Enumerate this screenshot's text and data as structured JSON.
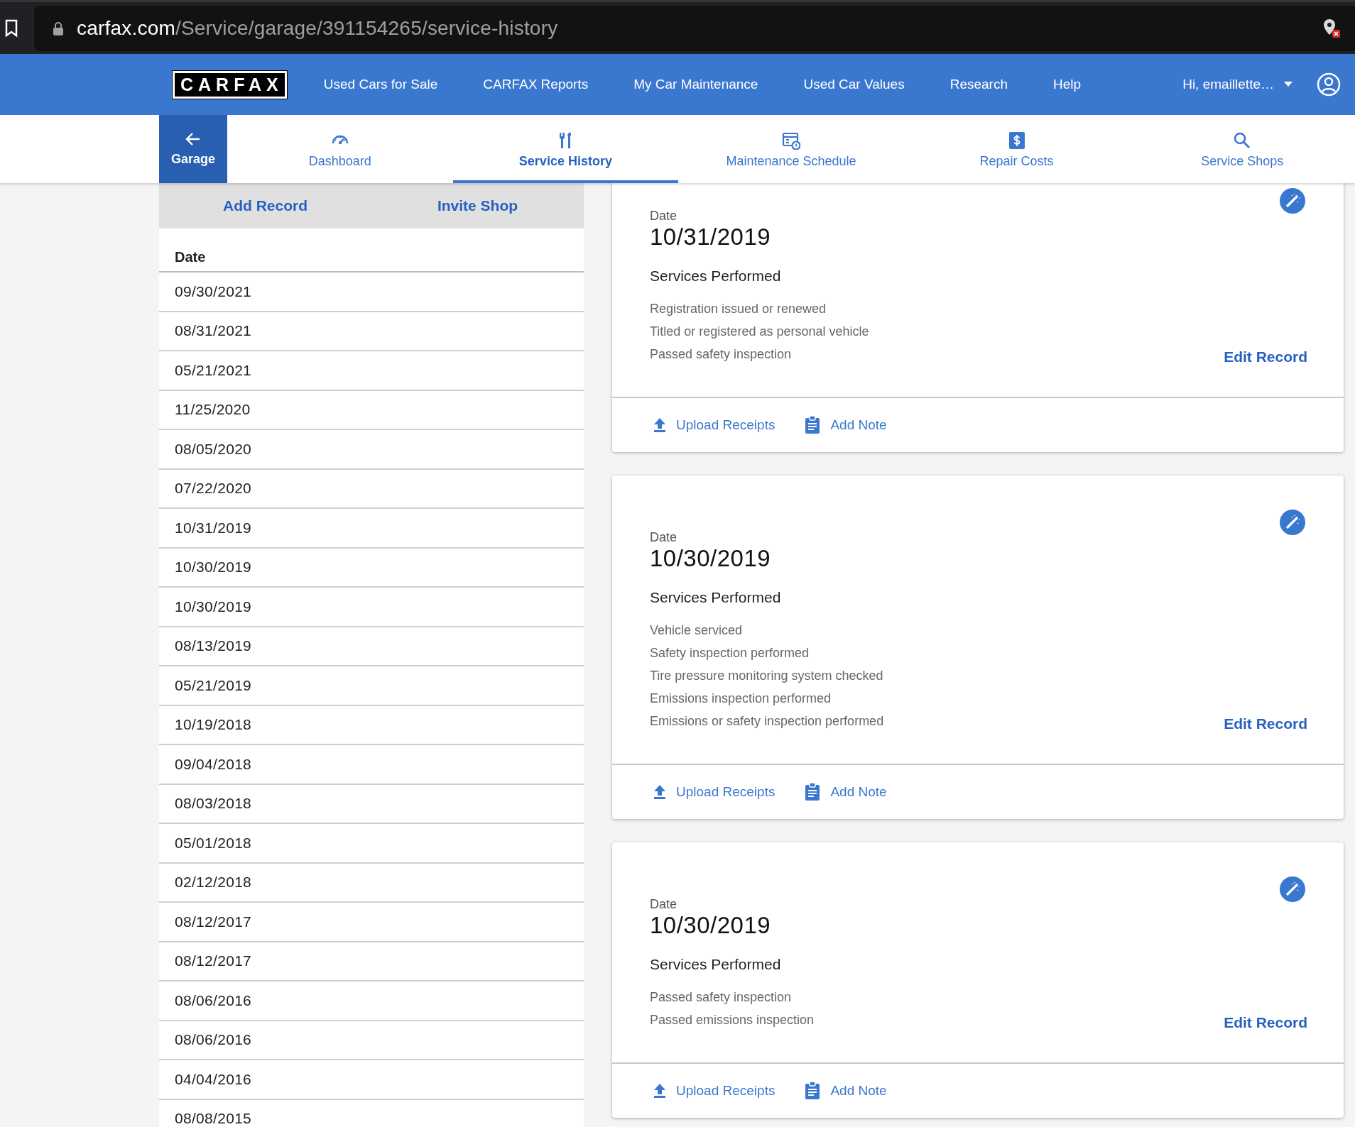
{
  "browser": {
    "url_host": "carfax.com",
    "url_path": "/Service/garage/391154265/service-history"
  },
  "header": {
    "logo": "CARFAX",
    "nav": [
      "Used Cars for Sale",
      "CARFAX Reports",
      "My Car Maintenance",
      "Used Car Values",
      "Research",
      "Help"
    ],
    "user": "Hi, emaillette…"
  },
  "tabs": [
    {
      "label": "Garage",
      "kind": "back",
      "selected": false
    },
    {
      "label": "Dashboard",
      "kind": "tab",
      "selected": false
    },
    {
      "label": "Service History",
      "kind": "tab",
      "selected": true
    },
    {
      "label": "Maintenance Schedule",
      "kind": "tab",
      "selected": false
    },
    {
      "label": "Repair Costs",
      "kind": "tab",
      "selected": false
    },
    {
      "label": "Service Shops",
      "kind": "tab",
      "selected": false
    }
  ],
  "history": {
    "actions": [
      "Add Record",
      "Invite Shop"
    ],
    "column": "Date",
    "rows": [
      "09/30/2021",
      "08/31/2021",
      "05/21/2021",
      "11/25/2020",
      "08/05/2020",
      "07/22/2020",
      "10/31/2019",
      "10/30/2019",
      "10/30/2019",
      "08/13/2019",
      "05/21/2019",
      "10/19/2018",
      "09/04/2018",
      "08/03/2018",
      "05/01/2018",
      "02/12/2018",
      "08/12/2017",
      "08/12/2017",
      "08/06/2016",
      "08/06/2016",
      "04/04/2016",
      "08/08/2015"
    ]
  },
  "records": [
    {
      "date_label": "Date",
      "date": "10/31/2019",
      "heading": "Services Performed",
      "services": [
        "Registration issued or renewed",
        "Titled or registered as personal vehicle",
        "Passed safety inspection"
      ],
      "edit": "Edit Record",
      "actions": [
        "Upload Receipts",
        "Add Note"
      ]
    },
    {
      "date_label": "Date",
      "date": "10/30/2019",
      "heading": "Services Performed",
      "services": [
        "Vehicle serviced",
        "Safety inspection performed",
        "Tire pressure monitoring system checked",
        "Emissions inspection performed",
        "Emissions or safety inspection performed"
      ],
      "edit": "Edit Record",
      "actions": [
        "Upload Receipts",
        "Add Note"
      ]
    },
    {
      "date_label": "Date",
      "date": "10/30/2019",
      "heading": "Services Performed",
      "services": [
        "Passed safety inspection",
        "Passed emissions inspection"
      ],
      "edit": "Edit Record",
      "actions": [
        "Upload Receipts",
        "Add Note"
      ]
    }
  ]
}
